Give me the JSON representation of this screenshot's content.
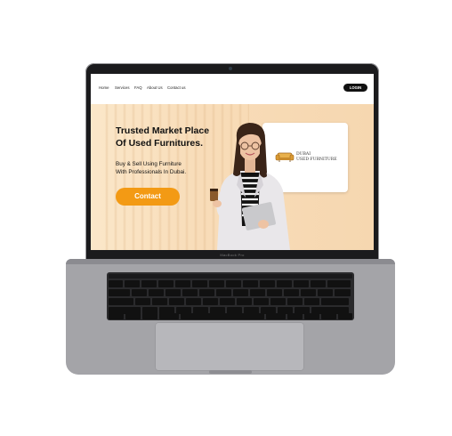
{
  "device": {
    "model_label": "MacBook Pro"
  },
  "site": {
    "nav": {
      "links": [
        "Home",
        "Services",
        "FAQ",
        "About Us",
        "Contact us"
      ],
      "login_label": "LOGIN"
    },
    "hero": {
      "title_line1": "Trusted Market Place",
      "title_line2": "Of Used Furnitures.",
      "subtitle_line1": "Buy & Sell Using Furniture",
      "subtitle_line2": "With Professionals In Dubai.",
      "contact_label": "Contact",
      "logo_line1": "DUBAI",
      "logo_line2": "USED FURNITURE"
    }
  },
  "colors": {
    "accent": "#f39a14",
    "hero_bg": "#f8dcb8",
    "login_bg": "#111111"
  }
}
